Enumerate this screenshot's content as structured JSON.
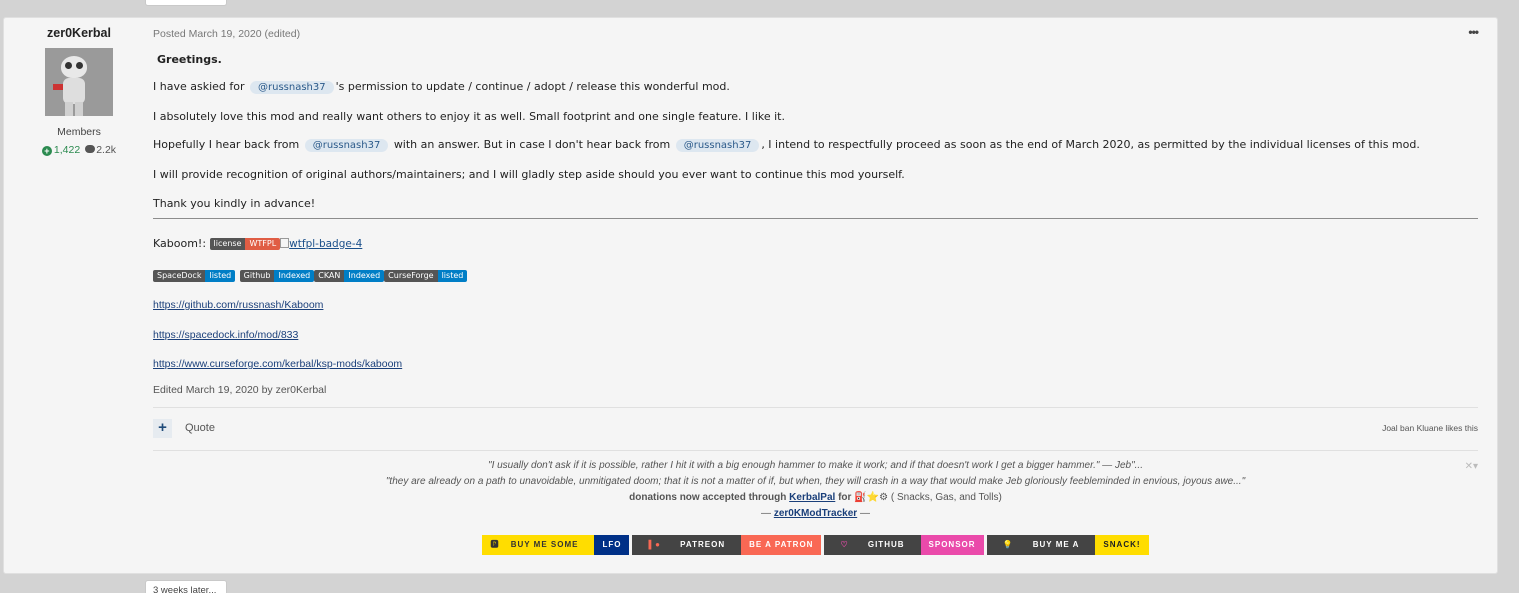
{
  "author": {
    "name": "zer0Kerbal",
    "group": "Members",
    "reputation": "1,422",
    "posts": "2.2k"
  },
  "post": {
    "meta": "Posted March 19, 2020 (edited)",
    "greeting": "Greetings.",
    "p1_before": "I have askied for",
    "p1_mention": "@russnash37",
    "p1_after": "'s permission to update / continue / adopt / release this wonderful mod.",
    "p2": "I absolutely love this mod and really want others to enjoy it as well. Small footprint and one single feature. I like it.",
    "p3_a": "Hopefully I hear back from",
    "p3_mention1": "@russnash37",
    "p3_b": "with an answer. But in case I don't hear back from",
    "p3_mention2": "@russnash37",
    "p3_c": ", I intend to respectfully proceed as soon as the end of March 2020, as permitted by the individual licenses of this mod.",
    "p4": "I will provide recognition of original authors/maintainers; and I will gladly step aside should you ever want to continue this mod yourself.",
    "p5": "Thank you kindly in advance!",
    "kaboom_label": "Kaboom!:",
    "license_badge": {
      "left": "license",
      "right": "WTFPL"
    },
    "broken_image_alt": "wtfpl-badge-4",
    "status_badges": [
      {
        "left": "SpaceDock",
        "right": "listed"
      },
      {
        "left": "Github",
        "right": "Indexed"
      },
      {
        "left": "CKAN",
        "right": "Indexed"
      },
      {
        "left": "CurseForge",
        "right": "listed"
      }
    ],
    "links": [
      "https://github.com/russnash/Kaboom",
      "https://spacedock.info/mod/833",
      "https://www.curseforge.com/kerbal/ksp-mods/kaboom"
    ],
    "edited": "Edited March 19, 2020 by zer0Kerbal",
    "quote_label": "Quote",
    "likes": "Joal ban Kluane likes this"
  },
  "signature": {
    "line1": "\"I usually don't ask if it is possible, rather I hit it with a big enough hammer to make it work; and if that doesn't work I get a bigger hammer.\" — Jeb\"...",
    "line2": "\"they are already on a path to unavoidable, unmitigated doom; that it is not a matter of if, but when, they will crash in a way that would make Jeb gloriously feebleminded in envious, joyous awe...\"",
    "line3_a": "donations now accepted through",
    "line3_link": "KerbalPal",
    "line3_b": "for",
    "line3_c": "( Snacks, Gas, and Tolls)",
    "line4_a": "—",
    "line4_link": "zer0KModTracker",
    "line4_b": "—",
    "sponsors": [
      {
        "left": "BUY ME SOME",
        "right": "LFO"
      },
      {
        "left": "PATREON",
        "right": "BE A PATRON"
      },
      {
        "left": "GITHUB",
        "right": "SPONSOR"
      },
      {
        "left": "BUY ME A",
        "right": "SNACK!"
      }
    ]
  },
  "bottom_tab": "3 weeks later...",
  "colors": {
    "page_bg": "#d3d3d3",
    "post_bg": "#f5f5f5",
    "reputation_green": "#2b8a4f",
    "link_blue": "#1a3f7a",
    "mention_bg": "#dde7f0"
  }
}
